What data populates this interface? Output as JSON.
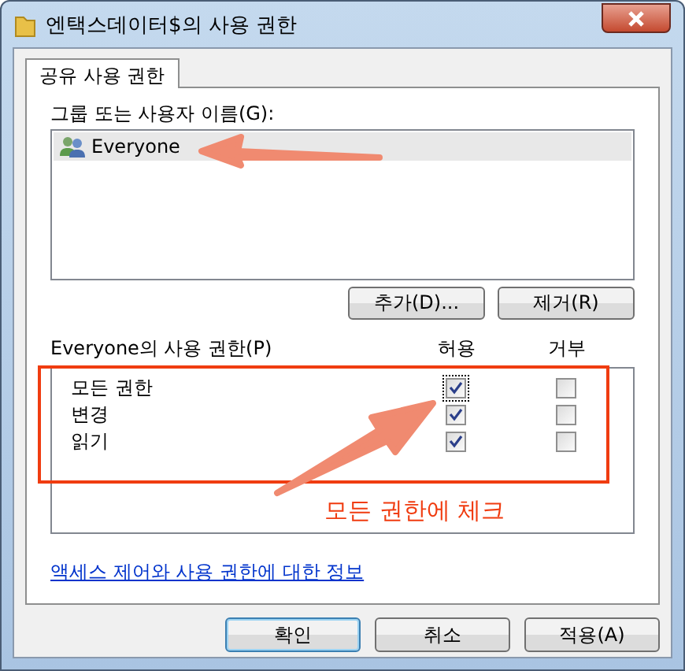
{
  "window": {
    "title": "엔택스데이터$의 사용 권한"
  },
  "tabs": [
    {
      "label": "공유 사용 권한",
      "selected": true
    }
  ],
  "users": {
    "label": "그룹 또는 사용자 이름(G):",
    "items": [
      {
        "name": "Everyone",
        "selected": true
      }
    ],
    "buttons": [
      "추가(D)...",
      "제거(R)"
    ]
  },
  "permissions": {
    "label": "Everyone의 사용 권한(P)",
    "columns": [
      "허용",
      "거부"
    ],
    "rows": [
      {
        "name": "모든 권한",
        "allow": true,
        "deny": false,
        "focused": true
      },
      {
        "name": "변경",
        "allow": true,
        "deny": false,
        "focused": false
      },
      {
        "name": "읽기",
        "allow": true,
        "deny": false,
        "focused": false
      }
    ]
  },
  "link": "액세스 제어와 사용 권한에 대한 정보",
  "buttons": [
    {
      "label": "확인",
      "default": true
    },
    {
      "label": "취소",
      "default": false
    },
    {
      "label": "적용(A)",
      "default": false
    }
  ],
  "annotation": {
    "text": "모든 권한에 체크"
  }
}
